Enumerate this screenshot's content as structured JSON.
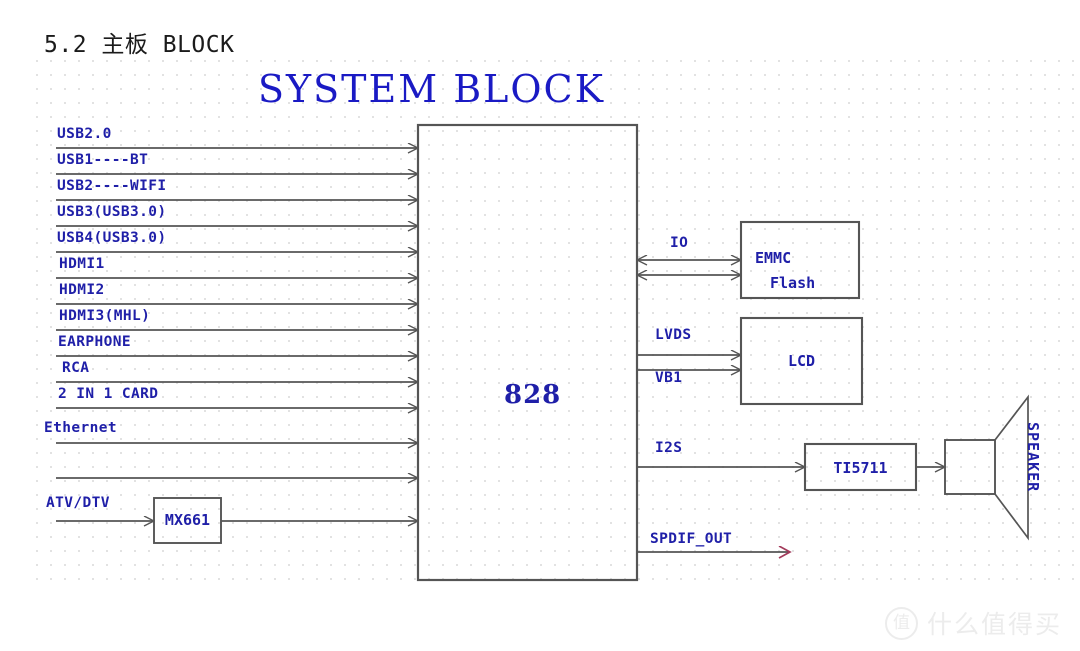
{
  "heading": "5.2 主板 BLOCK",
  "diagram": {
    "title": "SYSTEM BLOCK",
    "soc": {
      "label": "828"
    },
    "left_inputs": [
      {
        "label": "USB2.0"
      },
      {
        "label": "USB1----BT"
      },
      {
        "label": "USB2----WIFI"
      },
      {
        "label": "USB3(USB3.0)"
      },
      {
        "label": "USB4(USB3.0)"
      },
      {
        "label": "HDMI1"
      },
      {
        "label": "HDMI2"
      },
      {
        "label": "HDMI3(MHL)"
      },
      {
        "label": "EARPHONE"
      },
      {
        "label": "RCA"
      },
      {
        "label": "2 IN 1 CARD"
      },
      {
        "label": "Ethernet"
      },
      {
        "label": "ATV/DTV"
      }
    ],
    "tuner_block": {
      "label": "MX661"
    },
    "right_signals": [
      {
        "label": "IO"
      },
      {
        "label": "LVDS"
      },
      {
        "label": "VB1"
      },
      {
        "label": "I2S"
      },
      {
        "label": "SPDIF_OUT"
      }
    ],
    "right_blocks": [
      {
        "label_line1": "EMMC",
        "label_line2": "Flash"
      },
      {
        "label_line1": "LCD",
        "label_line2": ""
      },
      {
        "label_line1": "TI5711",
        "label_line2": ""
      }
    ],
    "speaker": {
      "label": "SPEAKER"
    },
    "colors": {
      "label_blue": "#1f1fa8",
      "title_blue": "#1a1ac4",
      "line_gray": "#555555",
      "spdif_arrow": "#a33a5b",
      "grid_dot": "#e2e2e2"
    }
  },
  "watermark": {
    "badge": "值",
    "text": "什么值得买"
  }
}
